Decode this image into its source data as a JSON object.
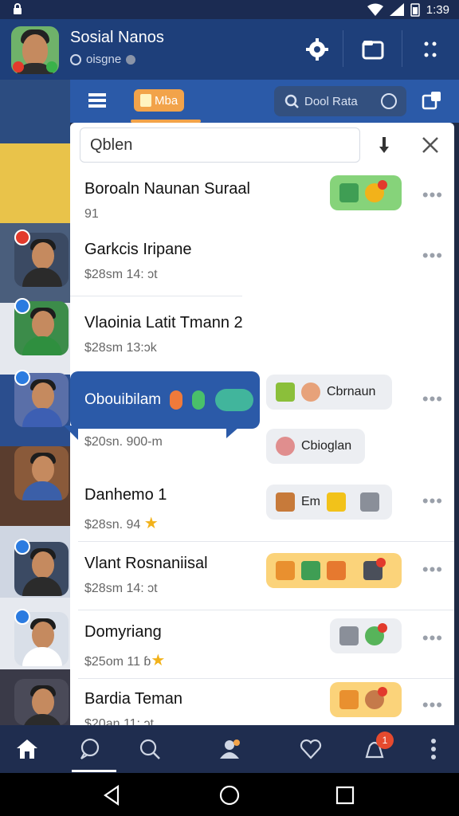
{
  "status_bar": {
    "time": "1:39"
  },
  "header": {
    "title": "Sosial Nanos",
    "subtitle": "oisgne"
  },
  "toolbar": {
    "tab_label": "Mba",
    "search_text": "Dool Rata"
  },
  "search": {
    "value": "Qblen"
  },
  "conversations": [
    {
      "name": "Boroaln Naunan Suraal",
      "meta": "91"
    },
    {
      "name": "Garkcis Iripane",
      "meta": "$28sm 14: ɔt"
    },
    {
      "name": "Vlaoinia Latit Tmann 2",
      "meta": "$28sm 13:ɔk"
    },
    {
      "name": "Obouibilam",
      "meta": "$20sn. 900-m",
      "chip1": "Cbrnaun",
      "chip2": "Cbioglan"
    },
    {
      "name": "Danhemo 1",
      "meta": "$28sn. 94",
      "chip": "Em"
    },
    {
      "name": "Vlant Rosnaniisal",
      "meta": "$28sm 14: ɔt"
    },
    {
      "name": "Domyriang",
      "meta": "$25om 11 ɓ"
    },
    {
      "name": "Bardia Teman",
      "meta": "$20an 11: ɔt"
    }
  ],
  "bottom_nav": {
    "badge_count": "1"
  },
  "colors": {
    "primary": "#2b5aa8",
    "header": "#1e3f7a",
    "accent": "#f2a34a",
    "nav": "#1f2d4f"
  }
}
